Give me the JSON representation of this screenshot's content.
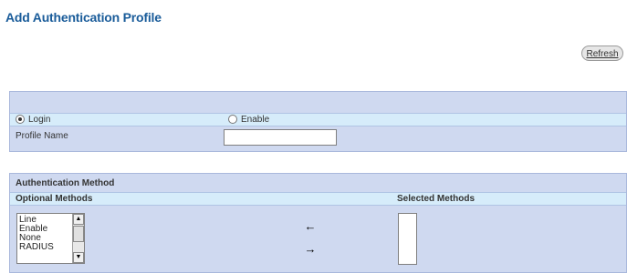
{
  "page": {
    "title": "Add Authentication Profile"
  },
  "toolbar": {
    "refresh_label": "Refresh"
  },
  "profile": {
    "login_label": "Login",
    "enable_label": "Enable",
    "selected": "login",
    "profile_name_label": "Profile Name",
    "profile_name_value": ""
  },
  "auth": {
    "title": "Authentication Method",
    "optional_label": "Optional Methods",
    "selected_label": "Selected Methods",
    "optional_items": [
      "Line",
      "Enable",
      "None",
      "RADIUS"
    ],
    "selected_items": [],
    "add_arrow": "←",
    "remove_arrow": "→"
  },
  "icons": {
    "scroll_up": "▲",
    "scroll_down": "▼"
  }
}
